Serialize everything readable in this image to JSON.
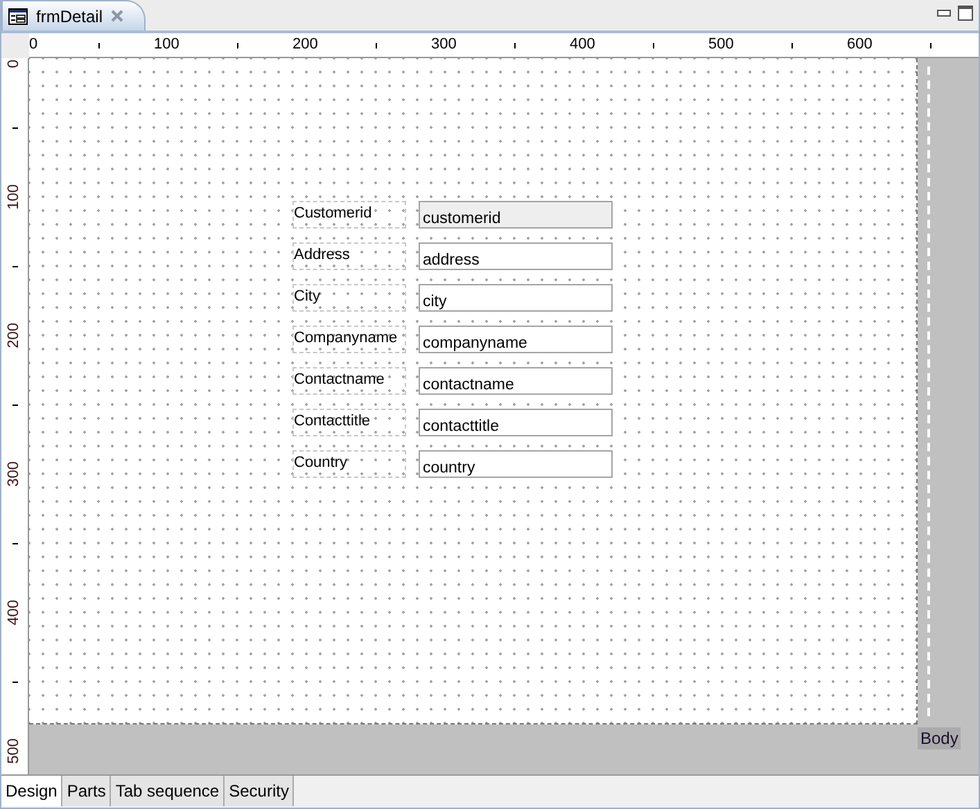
{
  "document_tab": {
    "title": "frmDetail"
  },
  "horizontal_ruler": {
    "labels": [
      "0",
      "100",
      "200",
      "300",
      "400",
      "500",
      "600"
    ]
  },
  "vertical_ruler": {
    "labels": [
      "0",
      "100",
      "200",
      "300",
      "400",
      "500"
    ]
  },
  "fields": [
    {
      "label": "Customerid",
      "value": "customerid",
      "disabled": true
    },
    {
      "label": "Address",
      "value": "address",
      "disabled": false
    },
    {
      "label": "City",
      "value": "city",
      "disabled": false
    },
    {
      "label": "Companyname",
      "value": "companyname",
      "disabled": false
    },
    {
      "label": "Contactname",
      "value": "contactname",
      "disabled": false
    },
    {
      "label": "Contacttitle",
      "value": "contacttitle",
      "disabled": false
    },
    {
      "label": "Country",
      "value": "country",
      "disabled": false
    }
  ],
  "section": {
    "label": "Body"
  },
  "bottom_tabs": [
    {
      "label": "Design",
      "selected": true
    },
    {
      "label": "Parts",
      "selected": false
    },
    {
      "label": "Tab sequence",
      "selected": false
    },
    {
      "label": "Security",
      "selected": false
    }
  ]
}
